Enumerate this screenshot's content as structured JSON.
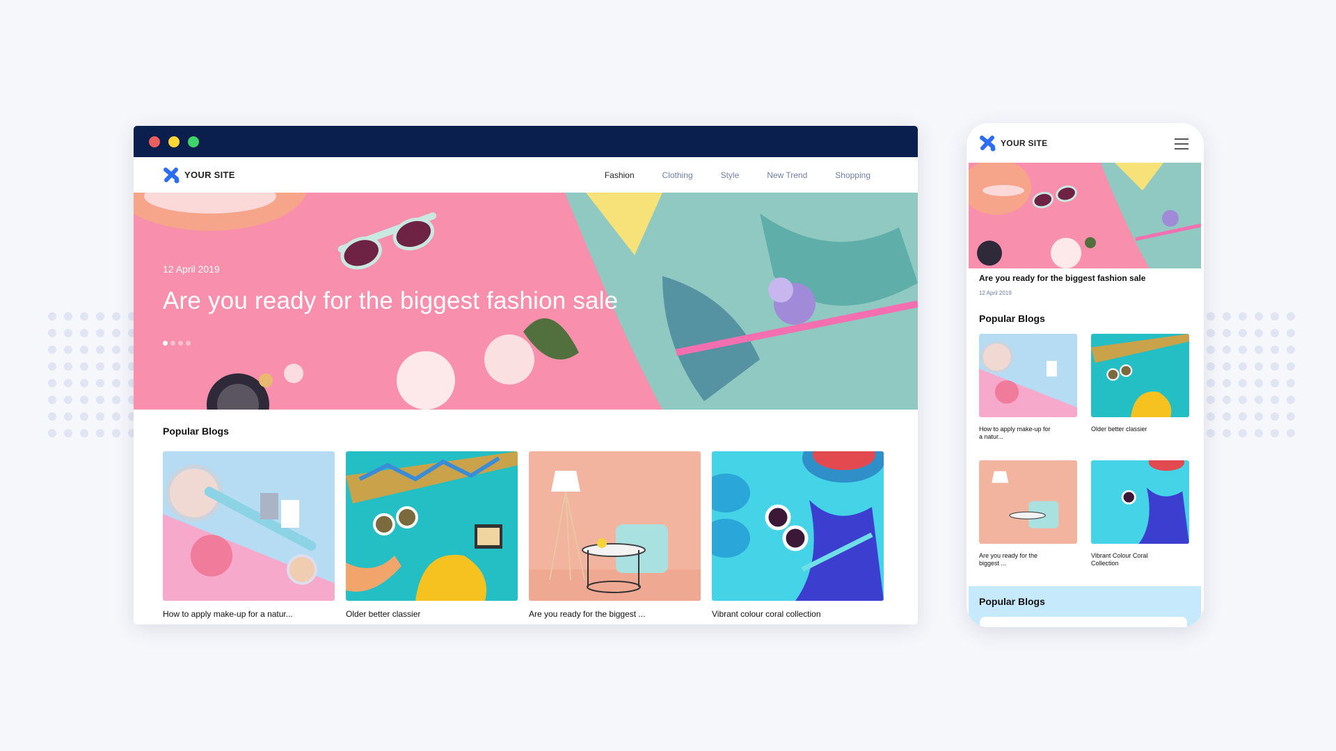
{
  "browser": {
    "traffic_lights": [
      {
        "name": "close",
        "color": "#ec5f5f"
      },
      {
        "name": "minimize",
        "color": "#fdd835"
      },
      {
        "name": "maximize",
        "color": "#3fd36c"
      }
    ],
    "titlebar_color": "#0b1f4e"
  },
  "site": {
    "logo_text": "YOUR SITE",
    "brand_color": "#2d6cf6",
    "nav": [
      {
        "label": "Fashion",
        "active": true
      },
      {
        "label": "Clothing",
        "active": false
      },
      {
        "label": "Style",
        "active": false
      },
      {
        "label": "New Trend",
        "active": false
      },
      {
        "label": "Shopping",
        "active": false
      }
    ],
    "hero": {
      "date": "12 April 2019",
      "title": "Are you ready for the biggest fashion sale",
      "slide_count": 4,
      "active_slide": 1
    },
    "popular_title": "Popular Blogs",
    "blogs": [
      {
        "caption": "How to apply make-up for a natur...",
        "image": "makeup-flatlay"
      },
      {
        "caption": "Older better classier",
        "image": "accessories-teal-flatlay"
      },
      {
        "caption": "Are you ready for the biggest ...",
        "image": "lamp-chair-interior"
      },
      {
        "caption": "Vibrant colour coral collection",
        "image": "blue-summer-flatlay"
      }
    ]
  },
  "mobile": {
    "logo_text": "YOUR SITE",
    "menu_icon": "hamburger-icon",
    "hero_title": "Are you ready for the biggest fashion sale",
    "hero_date": "12 April 2019",
    "popular_title": "Popular Blogs",
    "blogs": [
      {
        "caption": "How to apply make-up for a natur..."
      },
      {
        "caption": "Older better classier"
      },
      {
        "caption": "Are you ready for the biggest ..."
      },
      {
        "caption": "Vibrant Colour Coral Collection"
      }
    ],
    "footer_section_title": "Popular Blogs"
  }
}
